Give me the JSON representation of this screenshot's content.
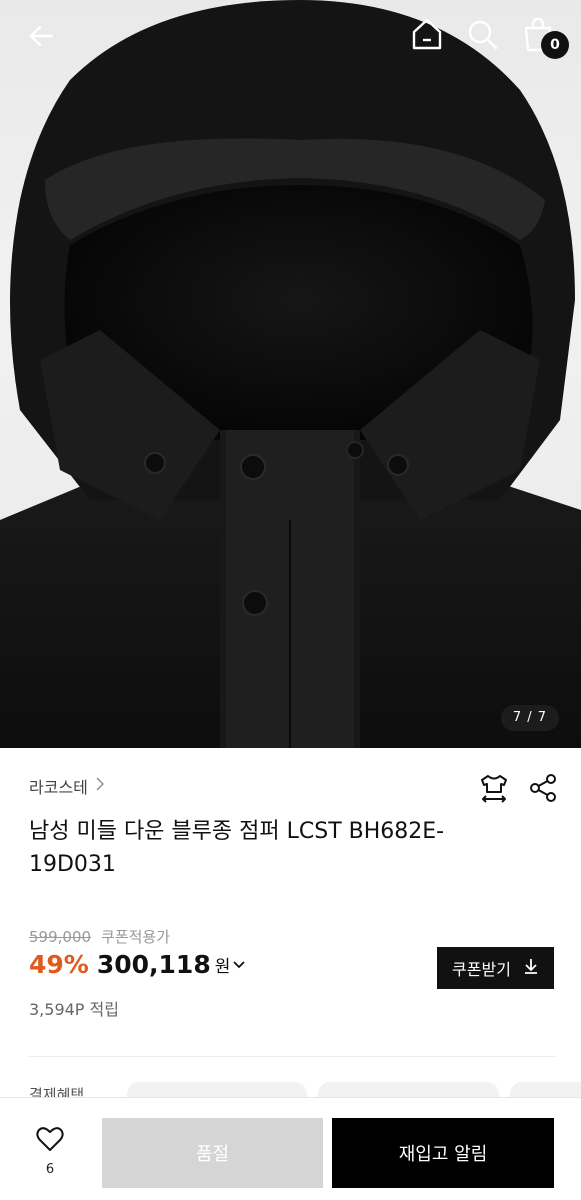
{
  "hero": {
    "counter": "7 / 7"
  },
  "header": {
    "cart_count": "0"
  },
  "product": {
    "brand": "라코스테",
    "title": "남성 미들 다운 블루종 점퍼 LCST BH682E-19D031",
    "original_price": "599,000",
    "coupon_price_label": "쿠폰적용가",
    "discount": "49%",
    "price": "300,118",
    "currency": "원",
    "coupon_button": "쿠폰받기",
    "points": "3,594P 적립",
    "benefit_label": "결제혜택"
  },
  "bottom": {
    "like_count": "6",
    "soldout_label": "품절",
    "notify_label": "재입고 알림"
  },
  "colors": {
    "accent": "#e05a1b",
    "primary": "#000000",
    "disabled": "#d5d5d5"
  },
  "icons": [
    "back-arrow-icon",
    "home-icon",
    "search-icon",
    "cart-icon",
    "size-guide-icon",
    "share-icon",
    "chevron-right-icon",
    "chevron-down-icon",
    "download-icon",
    "heart-icon"
  ]
}
